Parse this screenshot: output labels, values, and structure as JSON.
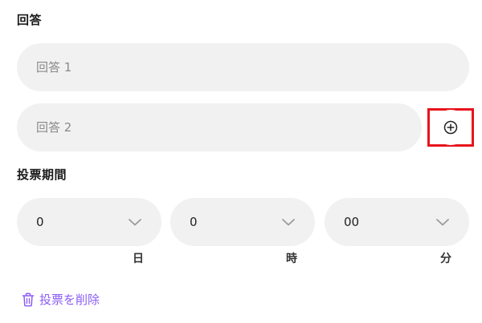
{
  "answers": {
    "heading": "回答",
    "items": [
      {
        "placeholder": "回答 1",
        "value": ""
      },
      {
        "placeholder": "回答 2",
        "value": ""
      }
    ],
    "add_icon": "plus-circle-icon"
  },
  "period": {
    "heading": "投票期間",
    "days": {
      "value": "0",
      "unit": "日"
    },
    "hours": {
      "value": "0",
      "unit": "時"
    },
    "minutes": {
      "value": "00",
      "unit": "分"
    },
    "dropdown_icon": "chevron-down-icon"
  },
  "remove": {
    "label": "投票を削除",
    "icon": "trash-icon",
    "color": "#8b5cf6"
  },
  "highlight_color": "#e8131b"
}
